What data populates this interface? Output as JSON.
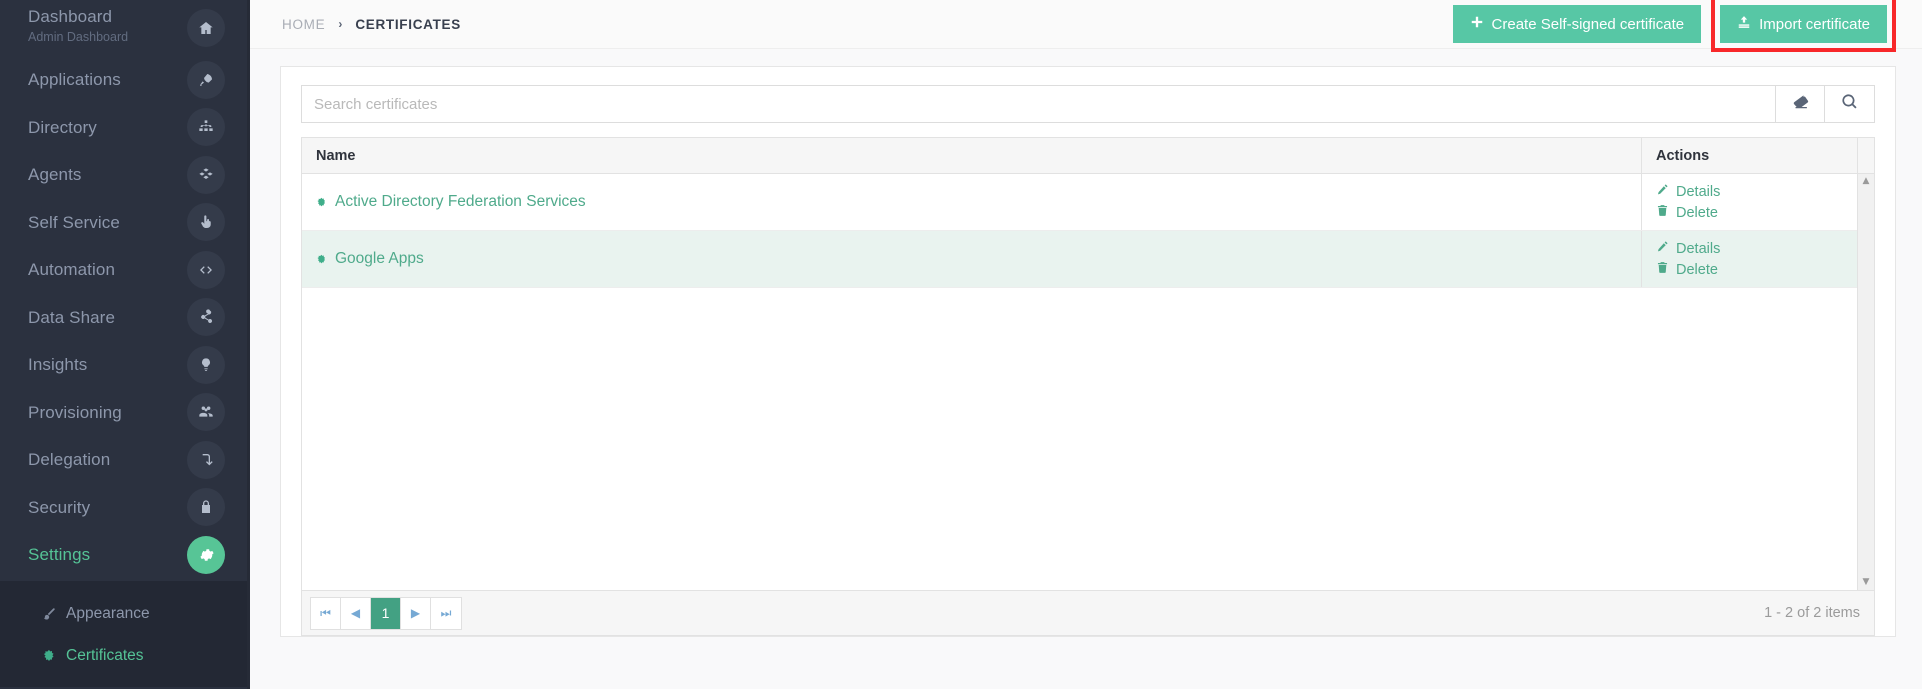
{
  "sidebar": {
    "items": [
      {
        "label": "Dashboard",
        "sublabel": "Admin Dashboard",
        "icon": "home-icon",
        "caret": "",
        "active": false
      },
      {
        "label": "Applications",
        "sublabel": "",
        "icon": "rocket-icon",
        "caret": "‹",
        "active": false
      },
      {
        "label": "Directory",
        "sublabel": "",
        "icon": "sitemap-icon",
        "caret": "‹",
        "active": false
      },
      {
        "label": "Agents",
        "sublabel": "",
        "icon": "cubes-icon",
        "caret": "",
        "active": false
      },
      {
        "label": "Self Service",
        "sublabel": "",
        "icon": "hand-pointer-icon",
        "caret": "‹",
        "active": false
      },
      {
        "label": "Automation",
        "sublabel": "",
        "icon": "code-icon",
        "caret": "‹",
        "active": false
      },
      {
        "label": "Data Share",
        "sublabel": "",
        "icon": "share-icon",
        "caret": "",
        "active": false
      },
      {
        "label": "Insights",
        "sublabel": "",
        "icon": "lightbulb-icon",
        "caret": "‹",
        "active": false
      },
      {
        "label": "Provisioning",
        "sublabel": "",
        "icon": "users-icon",
        "caret": "‹",
        "active": false
      },
      {
        "label": "Delegation",
        "sublabel": "",
        "icon": "arrow-turn-down-icon",
        "caret": "‹",
        "active": false
      },
      {
        "label": "Security",
        "sublabel": "",
        "icon": "lock-icon",
        "caret": "‹",
        "active": false
      },
      {
        "label": "Settings",
        "sublabel": "",
        "icon": "gear-icon",
        "caret": "⌄",
        "active": true
      }
    ],
    "submenu": [
      {
        "label": "Appearance",
        "icon": "paintbrush-icon",
        "selected": false
      },
      {
        "label": "Certificates",
        "icon": "certificate-icon",
        "selected": true
      }
    ]
  },
  "topbar": {
    "breadcrumb_home": "HOME",
    "breadcrumb_sep": "›",
    "breadcrumb_current": "CERTIFICATES",
    "create_button": "Create Self-signed certificate",
    "create_icon": "plus-icon",
    "import_button": "Import certificate",
    "import_icon": "upload-icon"
  },
  "search": {
    "placeholder": "Search certificates",
    "value": "",
    "clear_icon": "eraser-icon",
    "search_icon": "magnifier-icon"
  },
  "grid": {
    "columns": [
      "Name",
      "Actions"
    ],
    "rows": [
      {
        "name": "Active Directory Federation Services",
        "status_icon": "certificate-icon",
        "details_label": "Details",
        "details_icon": "pencil-icon",
        "delete_label": "Delete",
        "delete_icon": "trash-icon"
      },
      {
        "name": "Google Apps",
        "status_icon": "certificate-icon",
        "details_label": "Details",
        "details_icon": "pencil-icon",
        "delete_label": "Delete",
        "delete_icon": "trash-icon"
      }
    ],
    "scroll_up_icon": "caret-up-icon",
    "scroll_down_icon": "caret-down-icon"
  },
  "pager": {
    "first": "⏮",
    "prev": "◀",
    "current_page": "1",
    "next": "▶",
    "last": "⏭",
    "info": "1 - 2 of 2 items"
  },
  "colors": {
    "accent": "#57c7a5",
    "sidebar_bg": "#2b313f",
    "submenu_bg": "#232834",
    "row_alt": "#e9f3ef",
    "highlight": "#f8282a",
    "link": "#4faa8b"
  }
}
